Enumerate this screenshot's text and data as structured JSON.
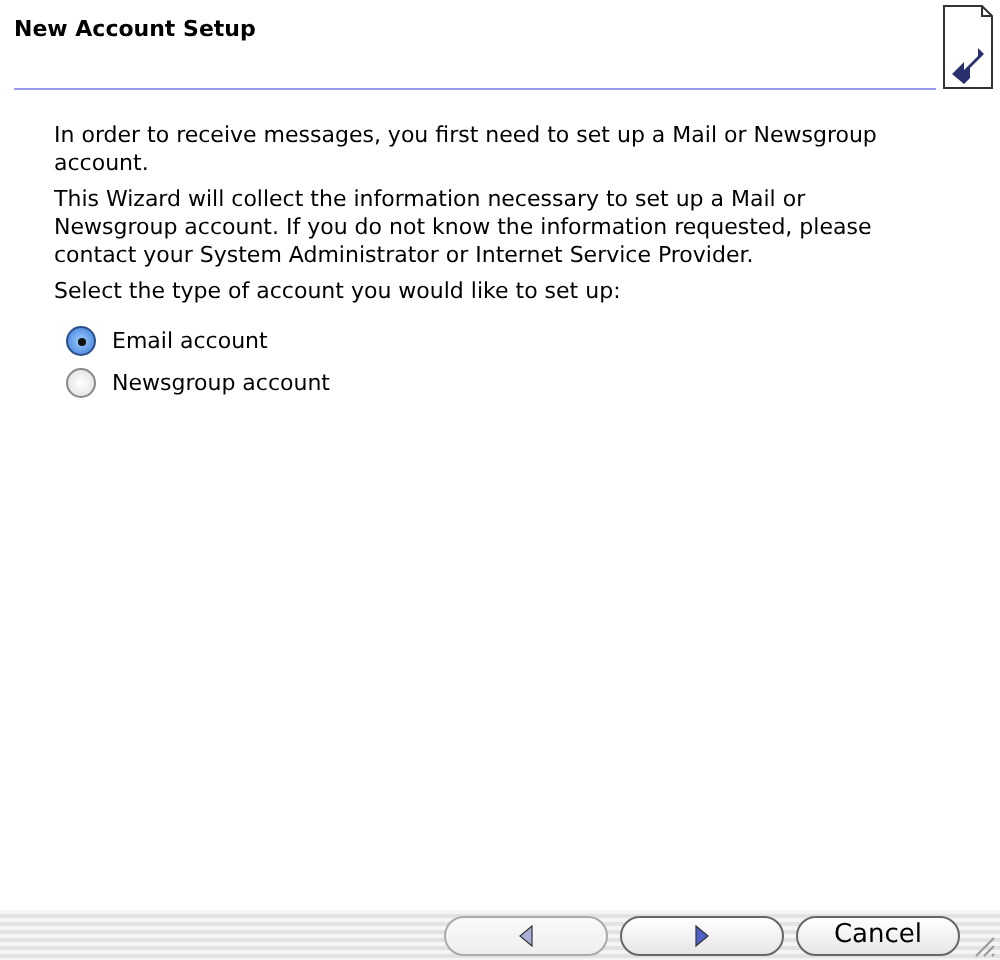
{
  "header": {
    "title": "New Account Setup"
  },
  "paragraphs": [
    "In order to receive messages, you first need to set up a Mail or Newsgroup account.",
    "This Wizard will collect the information necessary to set up a Mail or Newsgroup account. If you do not know the information requested, please contact your System Administrator or Internet Service Provider.",
    "Select the type of account you would like to set up:"
  ],
  "options": [
    {
      "label": "Email account",
      "selected": true
    },
    {
      "label": "Newsgroup account",
      "selected": false
    }
  ],
  "buttons": [
    {
      "kind": "back",
      "disabled": true
    },
    {
      "kind": "next",
      "disabled": false
    },
    {
      "kind": "cancel",
      "label": "Cancel",
      "disabled": false
    }
  ]
}
